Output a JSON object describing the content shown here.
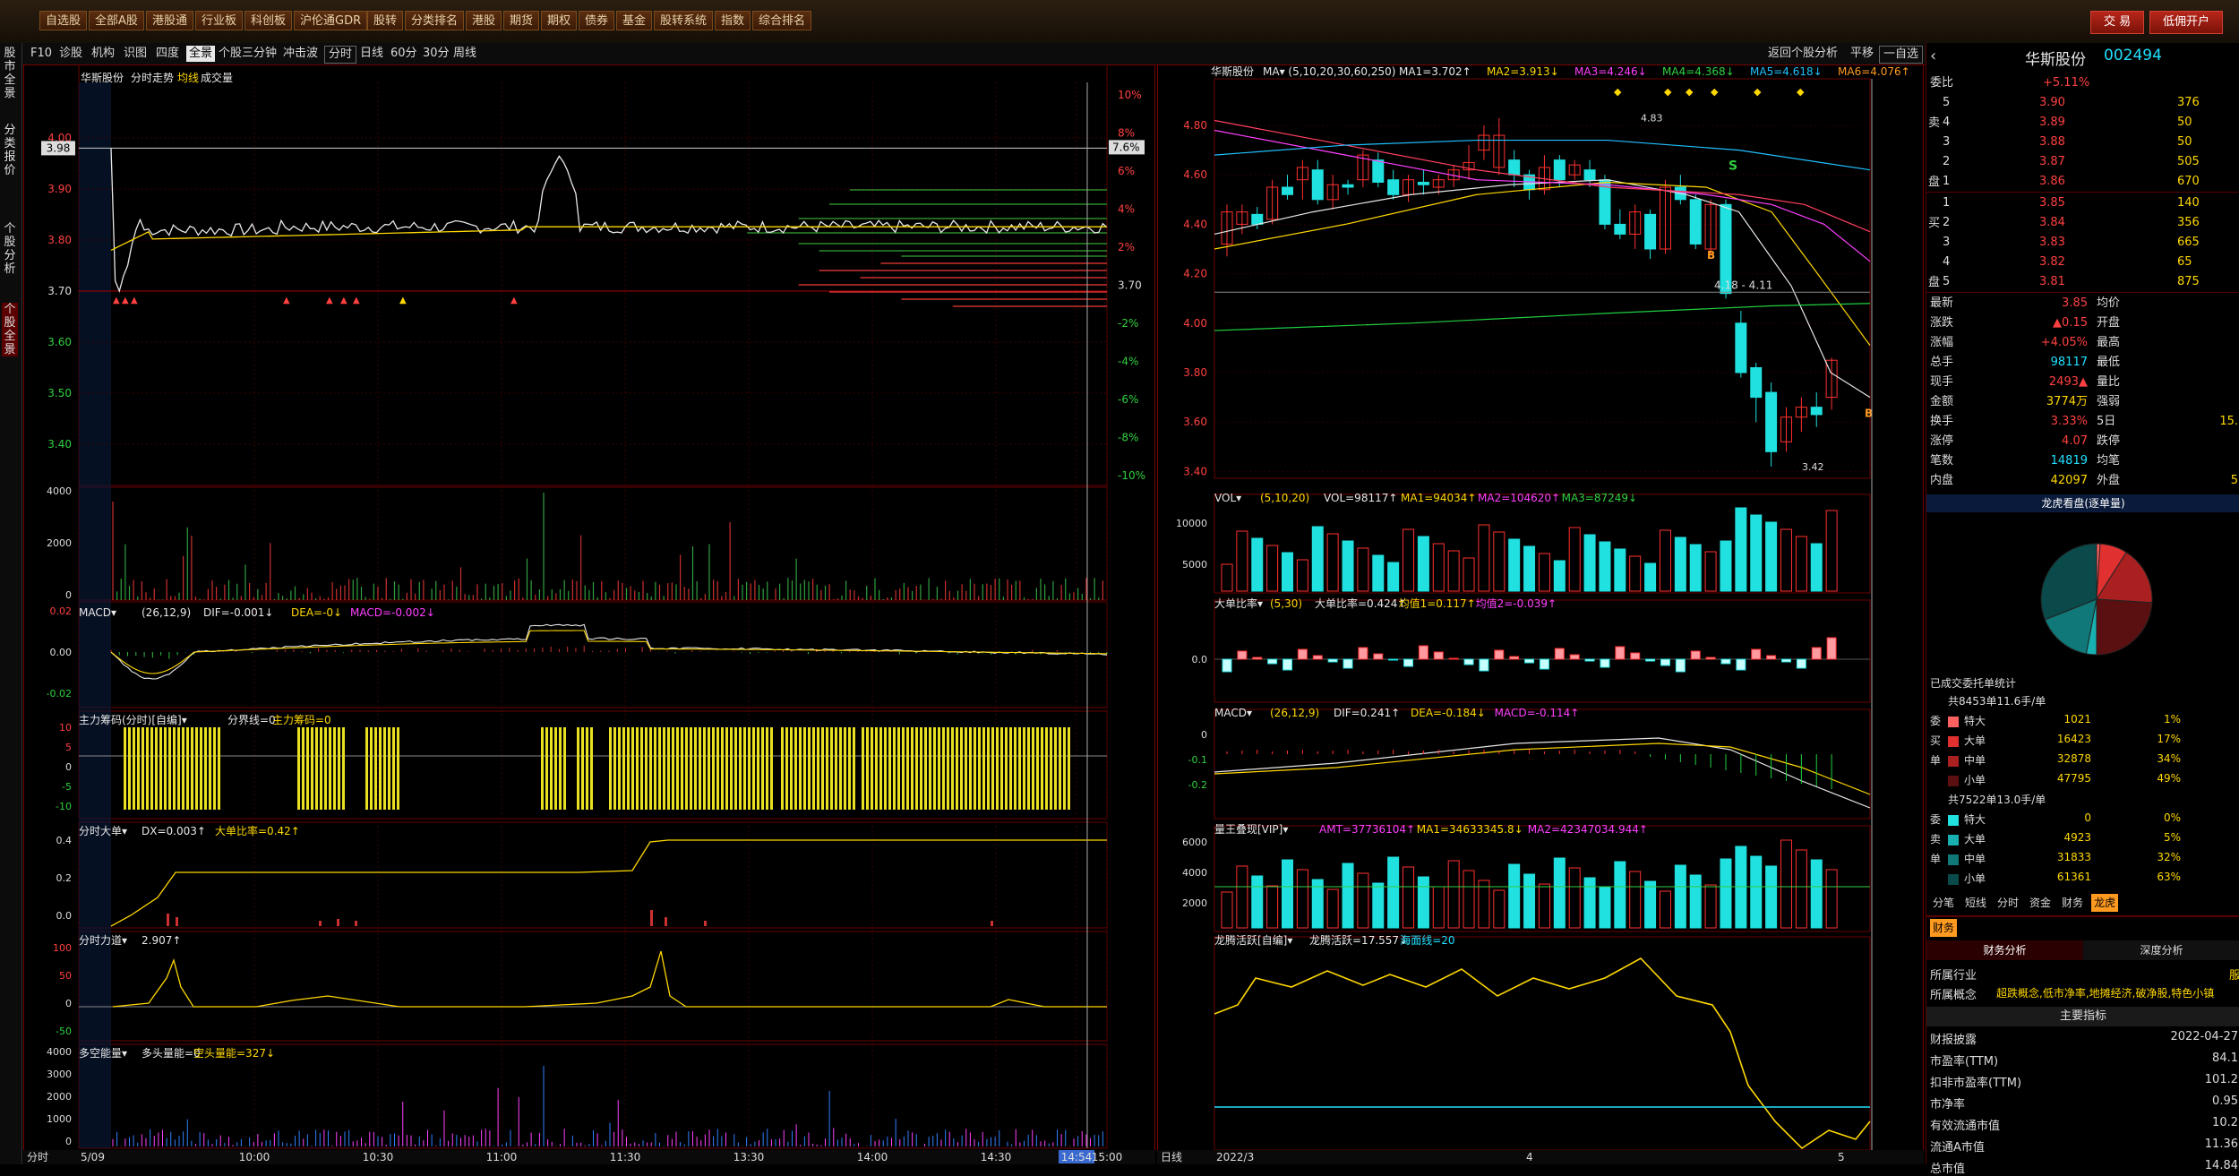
{
  "topbar": {
    "buttons": [
      "自选股",
      "全部A股",
      "港股通",
      "行业板",
      "科创板",
      "沪伦通GDR",
      "股转",
      "分类排名",
      "港股",
      "期货",
      "期权",
      "债券",
      "基金",
      "股转系统",
      "指数",
      "综合排名"
    ],
    "trade": "交 易",
    "open_account": "低佣开户"
  },
  "toolrow": {
    "items": [
      "F10",
      "诊股",
      "机构",
      "识图",
      "四度",
      "全景",
      "个股三分钟",
      "冲击波"
    ],
    "period_items": [
      "分时",
      "日线",
      "60分",
      "30分",
      "周线"
    ],
    "back": "返回个股分析",
    "flat": "平移",
    "watchlist": "一自选"
  },
  "lefttabs": [
    "股市全景",
    "分类报价",
    "个股分析",
    "个股全景"
  ],
  "intraday": {
    "header": "华斯股份  分时走势 均线 成交量",
    "name": "华斯股份",
    "title": "分时走势",
    "ma_label": "均线",
    "vol_label": "成交量",
    "price_ticks": [
      "4.00",
      "3.90",
      "3.80",
      "3.70",
      "3.60",
      "3.50",
      "3.40"
    ],
    "current_price": "3.98",
    "pct_ticks": [
      "10%",
      "8%",
      "6%",
      "4%",
      "2%",
      "3.70",
      "-2%",
      "-4%",
      "-6%",
      "-8%",
      "-10%"
    ],
    "current_pct": "7.6%",
    "vol_ticks": [
      "4000",
      "2000",
      "0"
    ],
    "time_ticks": [
      "5/09",
      "10:00",
      "10:30",
      "11:00",
      "11:30",
      "13:30",
      "14:00",
      "14:30",
      "14:54",
      "15:00"
    ],
    "footer": "分时"
  },
  "subpanels_left": [
    {
      "title": "MACD",
      "params": "(26,12,9)",
      "v1": "DIF=-0.001↓",
      "v2": "DEA=-0↓",
      "v3": "MACD=-0.002↓",
      "ticks": [
        "0.02",
        "0.00",
        "-0.02"
      ]
    },
    {
      "title": "主力筹码(分时)[自编]",
      "v1": "分界线=0",
      "v2": "主力筹码=0",
      "ticks": [
        "10",
        "5",
        "0",
        "-5",
        "-10"
      ]
    },
    {
      "title": "分时大单",
      "v1": "DX=0.003↑",
      "v2": "大单比率=0.42↑",
      "ticks": [
        "0.4",
        "0.2",
        "0.0"
      ]
    },
    {
      "title": "分时力道",
      "v1": "2.907↑",
      "ticks": [
        "100",
        "50",
        "0",
        "-50"
      ]
    },
    {
      "title": "多空能量",
      "v1": "多头量能=0",
      "v2": "空头量能=327↓",
      "ticks": [
        "4000",
        "3000",
        "2000",
        "1000",
        "0"
      ]
    }
  ],
  "daily": {
    "name": "华斯股份",
    "ma_params": "MA▾ (5,10,20,30,60,250)",
    "ma1": "MA1=3.702↑",
    "ma2": "MA2=3.913↓",
    "ma3": "MA3=4.246↓",
    "ma4": "MA4=4.368↓",
    "ma5": "MA5=4.618↓",
    "ma6": "MA6=4.076↑",
    "price_ticks": [
      "4.80",
      "4.60",
      "4.40",
      "4.20",
      "4.00",
      "3.80",
      "3.60",
      "3.40"
    ],
    "high_label": "4.83",
    "low_label": "3.42",
    "range_label": "4.18 - 4.11",
    "s_label": "S",
    "b_label": "B",
    "date_ticks": [
      "2022/3",
      "4",
      "5"
    ],
    "footer": "日线",
    "vol": {
      "title": "VOL",
      "params": "(5,10,20)",
      "v": "VOL=98117↑",
      "m1": "MA1=94034↑",
      "m2": "MA2=104620↑",
      "m3": "MA3=87249↓",
      "ticks": [
        "10000",
        "5000"
      ]
    },
    "ddr": {
      "title": "大单比率",
      "params": "(5,30)",
      "v": "大单比率=0.424↑",
      "m1": "均值1=0.117↑",
      "m2": "均值2=-0.039↑",
      "ticks": [
        "0.0"
      ]
    },
    "macd": {
      "title": "MACD",
      "params": "(26,12,9)",
      "v1": "DIF=0.241↑",
      "v2": "DEA=-0.184↓",
      "v3": "MACD=-0.114↑",
      "ticks": [
        "0",
        "-0.1",
        "-0.2"
      ]
    },
    "lw": {
      "title": "量王叠现[VIP]",
      "v": "AMT=37736104↑",
      "m1": "MA1=34633345.8↓",
      "m2": "MA2=42347034.944↑",
      "ticks": [
        "6000",
        "4000",
        "2000"
      ]
    },
    "lt": {
      "title": "龙腾活跃[自编]",
      "v": "龙腾活跃=17.557↓",
      "m": "海面线=20"
    }
  },
  "rpanel": {
    "name": "华斯股份",
    "code": "002494",
    "wb_label": "委比",
    "wb_value": "+5.11%",
    "asks": [
      [
        "5",
        "3.90",
        "376"
      ],
      [
        "4",
        "3.89",
        "50"
      ],
      [
        "3",
        "3.88",
        "50"
      ],
      [
        "2",
        "3.87",
        "505"
      ],
      [
        "1",
        "3.86",
        "670"
      ]
    ],
    "bids": [
      [
        "1",
        "3.85",
        "140"
      ],
      [
        "2",
        "3.84",
        "356"
      ],
      [
        "3",
        "3.83",
        "665"
      ],
      [
        "4",
        "3.82",
        "65"
      ],
      [
        "5",
        "3.81",
        "875"
      ]
    ],
    "ask_side": "卖",
    "bid_side": "买",
    "pan": "盘",
    "stats_left": [
      [
        "最新",
        "3.85"
      ],
      [
        "涨跌",
        "▲0.15"
      ],
      [
        "涨幅",
        "+4.05%"
      ],
      [
        "总手",
        "98117"
      ],
      [
        "现手",
        "2493▲"
      ],
      [
        "金额",
        "3774万"
      ],
      [
        "换手",
        "3.33%"
      ],
      [
        "涨停",
        "4.07"
      ],
      [
        "笔数",
        "14819"
      ],
      [
        "内盘",
        "42097"
      ]
    ],
    "stats_right": [
      [
        "均价",
        ""
      ],
      [
        "开盘",
        ""
      ],
      [
        "最高",
        ""
      ],
      [
        "最低",
        ""
      ],
      [
        "量比",
        ""
      ],
      [
        "强弱",
        ""
      ],
      [
        "5日",
        "15."
      ],
      [
        "跌停",
        ""
      ],
      [
        "均笔",
        ""
      ],
      [
        "外盘",
        "5"
      ]
    ],
    "pie_title": "龙虎看盘(逐单量)",
    "pie_sub": "已成交委托单统计",
    "buy_head": "共8453单11.6手/单",
    "buy_rows": [
      [
        "特大",
        "1021",
        "1%"
      ],
      [
        "大单",
        "16423",
        "17%"
      ],
      [
        "中单",
        "32878",
        "34%"
      ],
      [
        "小单",
        "47795",
        "49%"
      ]
    ],
    "sell_head": "共7522单13.0手/单",
    "sell_rows": [
      [
        "特大",
        "0",
        "0%"
      ],
      [
        "大单",
        "4923",
        "5%"
      ],
      [
        "中单",
        "31833",
        "32%"
      ],
      [
        "小单",
        "61361",
        "63%"
      ]
    ],
    "buy_side": [
      "委",
      "买",
      "单"
    ],
    "sell_side": [
      "委",
      "卖",
      "单"
    ],
    "tabs": [
      "分笔",
      "短线",
      "分时",
      "资金",
      "财务",
      "龙虎"
    ],
    "fin_tab": "财务",
    "fin_subtabs": [
      "财务分析",
      "深度分析"
    ],
    "industry_label": "所属行业",
    "industry_value": "服",
    "concept_label": "所属概念",
    "concept_value": "超跌概念,低市净率,地摊经济,破净股,特色小镇",
    "key_head": "主要指标",
    "fin_rows": [
      [
        "财报披露",
        "2022-04-27"
      ],
      [
        "市盈率(TTM)",
        "84.1"
      ],
      [
        "扣非市盈率(TTM)",
        "101.2"
      ],
      [
        "市净率",
        "0.95"
      ],
      [
        "有效流通市值",
        "10.2"
      ],
      [
        "流通A市值",
        "11.36"
      ],
      [
        "总市值",
        "14.84"
      ]
    ]
  }
}
